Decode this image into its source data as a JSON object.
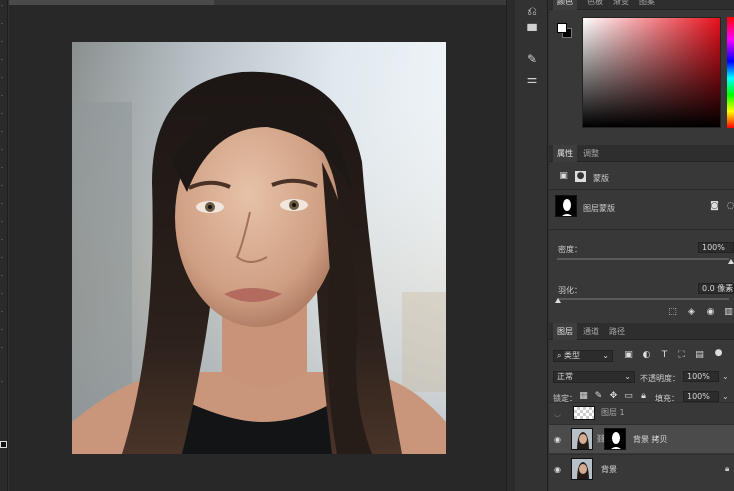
{
  "panel_tabs_top": [
    "颜色",
    "色板",
    "渐变",
    "图案"
  ],
  "properties": {
    "tabs": [
      "属性",
      "调整"
    ],
    "mask_header": "蒙版",
    "mask_type": "图层蒙版",
    "density_label": "密度：",
    "density_value": "100%",
    "feather_label": "羽化：",
    "feather_value": "0.0 像素"
  },
  "layers_panel": {
    "tabs": [
      "图层",
      "通道",
      "路径"
    ],
    "filter_label": "类型",
    "blend_mode": "正常",
    "opacity_label": "不透明度：",
    "opacity_value": "100%",
    "lock_label": "锁定：",
    "fill_label": "填充：",
    "fill_value": "100%",
    "layers": [
      {
        "name": "图层 1",
        "visible": false,
        "selected": false
      },
      {
        "name": "背景 拷贝",
        "visible": true,
        "selected": true
      },
      {
        "name": "背景",
        "visible": true,
        "selected": false
      }
    ]
  },
  "colors": {
    "picker_hue": "#e8101c",
    "selected_layer_bg": "#4b4b4b"
  }
}
